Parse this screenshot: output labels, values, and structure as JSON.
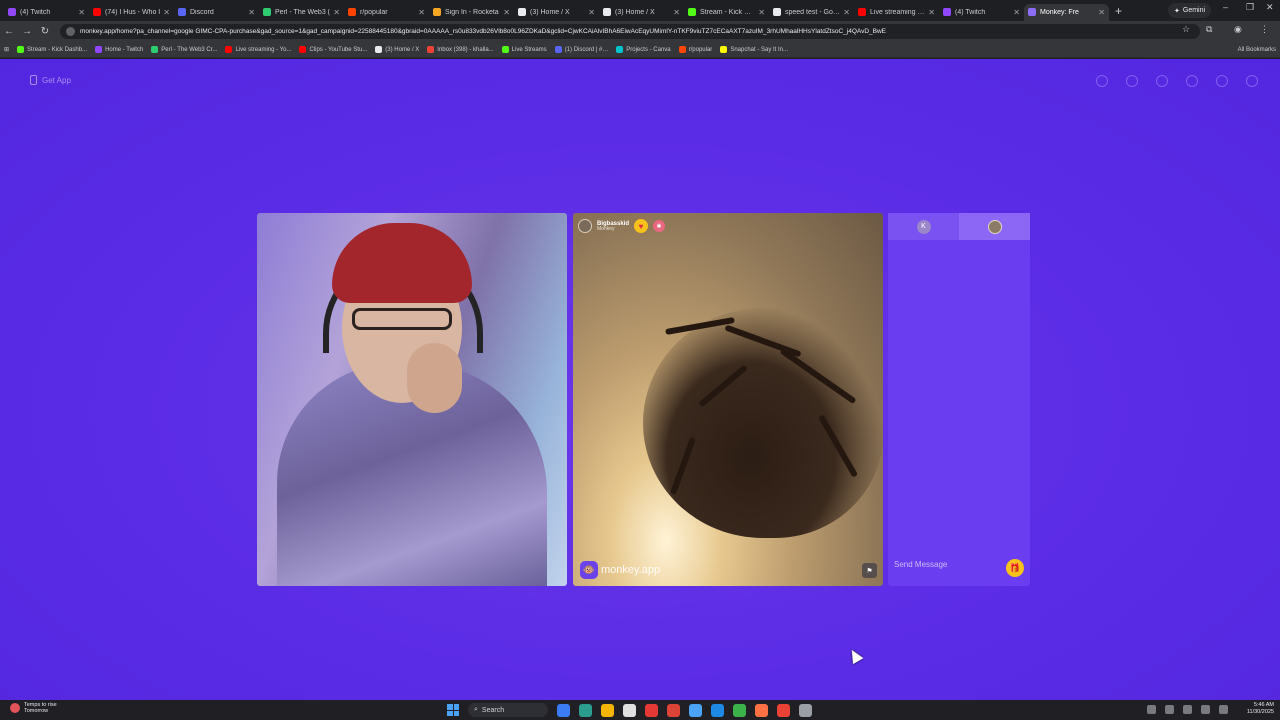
{
  "browser": {
    "tabs": [
      {
        "label": "(4) Twitch",
        "color": "#9146ff"
      },
      {
        "label": "(74) I Hus - Who I",
        "color": "#ff0000"
      },
      {
        "label": "Discord",
        "color": "#5865f2"
      },
      {
        "label": "Perl - The Web3 (",
        "color": "#2ecc71"
      },
      {
        "label": "r/popular",
        "color": "#ff4500"
      },
      {
        "label": "Sign In - Rocketa",
        "color": "#f5a623"
      },
      {
        "label": "(3) Home / X",
        "color": "#e8eaed"
      },
      {
        "label": "(3) Home / X",
        "color": "#e8eaed"
      },
      {
        "label": "Stream - Kick Das",
        "color": "#53fc18"
      },
      {
        "label": "speed test - Goog",
        "color": "#e8eaed"
      },
      {
        "label": "Live streaming - Y",
        "color": "#ff0000"
      },
      {
        "label": "(4) Twitch",
        "color": "#9146ff"
      },
      {
        "label": "Monkey: Fre",
        "color": "#8b6cf2",
        "active": true
      }
    ],
    "new_tab": "+",
    "gemini_label": "Gemini",
    "url": "monkey.app/home?pa_channel=google GIMC-CPA-purchase&gad_source=1&gad_campaignid=22588445180&gbraid=0AAAAA_rs0u833vdb26Vlb8o0L96ZDKaD&gclid=CjwKCAiAlvIBhA6EiwAcEqyUMimlY-nTKF9viuTZ7cECaAXT7azuIM_3rhUMhaalHHsYlatdZtsoC_j4QAvD_BwE",
    "bookmarks": [
      {
        "label": "Stream - Kick Dashb...",
        "color": "#53fc18"
      },
      {
        "label": "Home - Twitch",
        "color": "#9146ff"
      },
      {
        "label": "Perl - The Web3 Cr...",
        "color": "#2ecc71"
      },
      {
        "label": "Live streaming - Yo...",
        "color": "#ff0000"
      },
      {
        "label": "Clips - YouTube Stu...",
        "color": "#ff0000"
      },
      {
        "label": "(3) Home / X",
        "color": "#e8eaed"
      },
      {
        "label": "Inbox (398) - khalla...",
        "color": "#ea4335"
      },
      {
        "label": "Live Streams",
        "color": "#53fc18"
      },
      {
        "label": "(1) Discord | #…",
        "color": "#5865f2"
      },
      {
        "label": "Projects - Canva",
        "color": "#00c4cc"
      },
      {
        "label": "r/popular",
        "color": "#ff4500"
      },
      {
        "label": "Snapchat - Say It In...",
        "color": "#fffc00"
      }
    ],
    "all_bookmarks": "All Bookmarks"
  },
  "page": {
    "get_app": "Get App",
    "remote": {
      "username": "Bigbasskid",
      "subtitle": "Monkey",
      "watermark": "monkey.app"
    },
    "chat": {
      "left_avatar_letter": "K",
      "placeholder": "Send Message"
    }
  },
  "taskbar": {
    "weather_line1": "Temps to rise",
    "weather_line2": "Tomorrow",
    "search_label": "Search",
    "time": "5:46 AM",
    "date": "11/30/2025",
    "apps": [
      "#3b7cf4",
      "#2a9d8f",
      "#f4b400",
      "#e0e0e0",
      "#e53935",
      "#db4437",
      "#4aa3f7",
      "#1e88e5",
      "#3bb34a",
      "#ff7043",
      "#ea4335",
      "#9aa0a6"
    ]
  }
}
